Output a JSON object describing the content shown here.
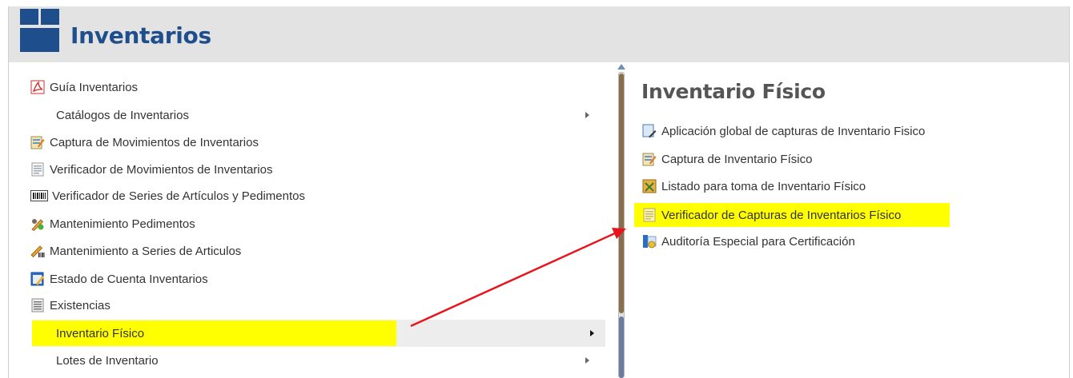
{
  "header": {
    "title": "Inventarios",
    "icon": "box-icon",
    "icon_color": "#1f4e8c"
  },
  "menu": {
    "items": [
      {
        "label": "Guía Inventarios",
        "icon": "pdf-icon"
      },
      {
        "label": "Catálogos de Inventarios",
        "submenu": true
      },
      {
        "label": "Captura de Movimientos de Inventarios",
        "icon": "edit-form-icon"
      },
      {
        "label": "Verificador de Movimientos de Inventarios",
        "icon": "document-icon"
      },
      {
        "label": "Verificador de Series de Artículos y Pedimentos",
        "icon": "barcode-icon"
      },
      {
        "label": "Mantenimiento Pedimentos",
        "icon": "pencil-paint-icon"
      },
      {
        "label": "Mantenimiento a Series de Articulos",
        "icon": "pencil-barcode-icon"
      },
      {
        "label": "Estado de Cuenta Inventarios",
        "icon": "notepad-pencil-icon"
      },
      {
        "label": "Existencias",
        "icon": "document-lines-icon"
      },
      {
        "label": "Inventario Físico",
        "submenu": true,
        "active": true
      },
      {
        "label": "Lotes de Inventario",
        "submenu": true
      }
    ]
  },
  "submenu": {
    "title": "Inventario Físico",
    "items": [
      {
        "label": "Aplicación global de capturas de Inventario Fisico",
        "icon": "apply-document-icon"
      },
      {
        "label": "Captura de Inventario Físico",
        "icon": "edit-form-icon"
      },
      {
        "label": "Listado para toma de Inventario Físico",
        "icon": "checklist-icon"
      },
      {
        "label": "Verificador de Capturas de Inventarios Físico",
        "icon": "document-icon",
        "highlighted": true
      },
      {
        "label": "Auditoría Especial para Certificación",
        "icon": "audit-icon"
      }
    ]
  },
  "colors": {
    "highlight": "#ffff00",
    "arrow": "#e8141c",
    "header_bg": "#e3e3e3"
  }
}
